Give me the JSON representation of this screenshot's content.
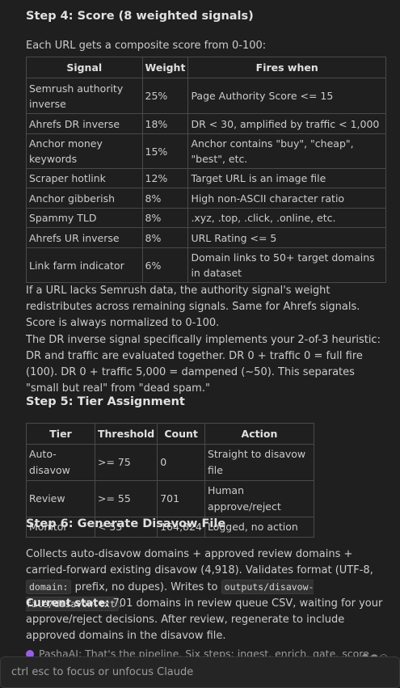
{
  "step4": {
    "heading": "Step 4: Score (8 weighted signals)",
    "intro": "Each URL gets a composite score from 0-100:",
    "columns": [
      "Signal",
      "Weight",
      "Fires when"
    ],
    "rows": [
      [
        "Semrush authority inverse",
        "25%",
        "Page Authority Score <= 15"
      ],
      [
        "Ahrefs DR inverse",
        "18%",
        "DR < 30, amplified by traffic < 1,000"
      ],
      [
        "Anchor money keywords",
        "15%",
        "Anchor contains \"buy\", \"cheap\", \"best\", etc."
      ],
      [
        "Scraper hotlink",
        "12%",
        "Target URL is an image file"
      ],
      [
        "Anchor gibberish",
        "8%",
        "High non-ASCII character ratio"
      ],
      [
        "Spammy TLD",
        "8%",
        ".xyz, .top, .click, .online, etc."
      ],
      [
        "Ahrefs UR inverse",
        "8%",
        "URL Rating <= 5"
      ],
      [
        "Link farm indicator",
        "6%",
        "Domain links to 50+ target domains in dataset"
      ]
    ],
    "note1": "If a URL lacks Semrush data, the authority signal's weight redistributes across remaining signals. Same for Ahrefs signals. Score is always normalized to 0-100.",
    "note2": "The DR inverse signal specifically implements your 2-of-3 heuristic: DR and traffic are evaluated together. DR 0 + traffic 0 = full fire (100). DR 0 + traffic 5,000 = dampened (~50). This separates \"small but real\" from \"dead spam.\""
  },
  "step5": {
    "heading": "Step 5: Tier Assignment",
    "columns": [
      "Tier",
      "Threshold",
      "Count",
      "Action"
    ],
    "rows": [
      [
        "Auto-disavow",
        ">= 75",
        "0",
        "Straight to disavow file"
      ],
      [
        "Review",
        ">= 55",
        "701",
        "Human approve/reject"
      ],
      [
        "Monitor",
        "< 55",
        "164,824",
        "Logged, no action"
      ]
    ]
  },
  "step6": {
    "heading": "Step 6: Generate Disavow File",
    "p_part1": "Collects auto-disavow domains + approved review domains + carried-forward existing disavow (4,918). Validates format (UTF-8, ",
    "code1": "domain:",
    "p_part2": " prefix, no dupes). Writes to ",
    "code2": "outputs/disavow-file/disavow.txt",
    "p_part3": ".",
    "current_label": "Current state:",
    "current_text": " 701 domains in review queue CSV, waiting for your approve/reject decisions. After review, regenerate to include approved domains in the disavow file."
  },
  "trailing_message": "PashaAI: That's the pipeline. Six steps: ingest, enrich, gate, score, tier,",
  "footer": {
    "hint": "ctrl esc to focus or unfocus Claude"
  },
  "colors": {
    "background": "#1f1f1f",
    "text": "#cccccc",
    "border": "#4a4a4a",
    "avatar": "#9b5de5"
  }
}
